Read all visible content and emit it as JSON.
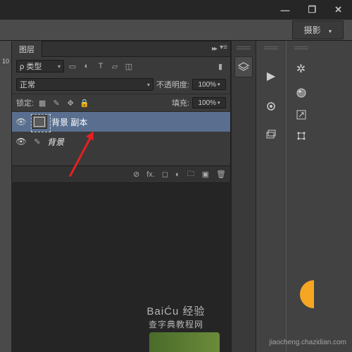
{
  "titlebar": {
    "minimize": "—",
    "maximize": "❐",
    "close": "✕"
  },
  "options": {
    "workspace": "摄影"
  },
  "ruler": {
    "mark": "10"
  },
  "layersPanel": {
    "title": "图层",
    "kindLabel": "ρ 类型",
    "blendMode": "正常",
    "opacityLabel": "不透明度:",
    "opacityValue": "100%",
    "lockLabel": "锁定:",
    "fillLabel": "填充:",
    "fillValue": "100%",
    "layers": [
      {
        "name": "背景 副本",
        "visible": true,
        "active": true
      },
      {
        "name": "背景",
        "visible": true,
        "active": false
      }
    ]
  },
  "watermark": {
    "main": "BaiĆu 经验",
    "sub": "",
    "site": "查字典教程网",
    "url": "jiaocheng.chazidian.com"
  }
}
